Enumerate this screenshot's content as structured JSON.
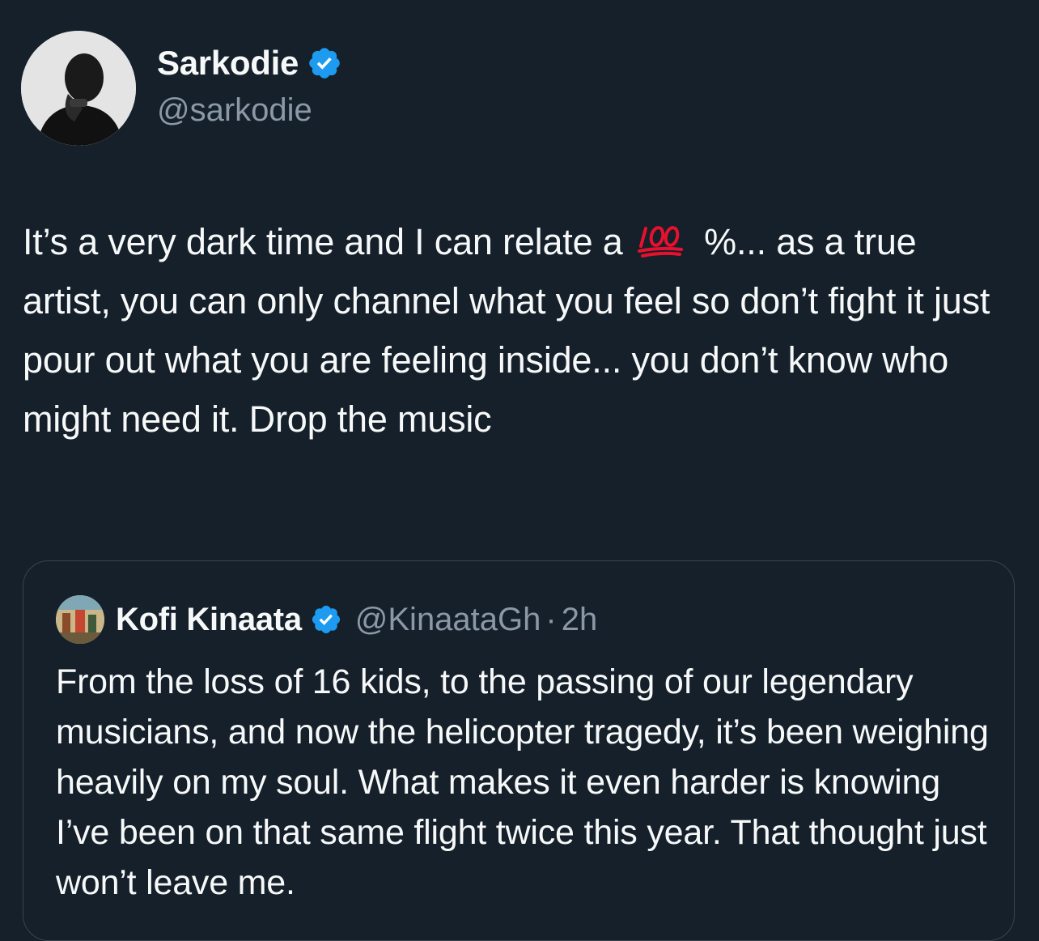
{
  "author": {
    "display_name": "Sarkodie",
    "handle": "@sarkodie",
    "verified": true
  },
  "tweet": {
    "text_before_emoji": "It’s a very dark time and I can relate a",
    "emoji": "hundred-points-emoji",
    "text_after_emoji": "%... as a true artist, you can only channel what you feel so don’t fight it just pour out what you are feeling inside... you don’t know who might need it. Drop the music"
  },
  "quoted_tweet": {
    "display_name": "Kofi Kinaata",
    "handle": "@KinaataGh",
    "separator": "·",
    "time": "2h",
    "verified": true,
    "text": "From the loss of 16 kids, to the passing of our legendary musicians, and now the helicopter tragedy, it’s been weighing heavily on my soul. What makes it even harder is knowing I’ve been on that same flight twice this year. That thought just won’t leave me."
  },
  "colors": {
    "background": "#15202b",
    "text": "#f7f9f9",
    "secondary_text": "#8b98a5",
    "verified_blue": "#1d9bf0",
    "border": "#38444d",
    "emoji_red": "#e8112d"
  }
}
